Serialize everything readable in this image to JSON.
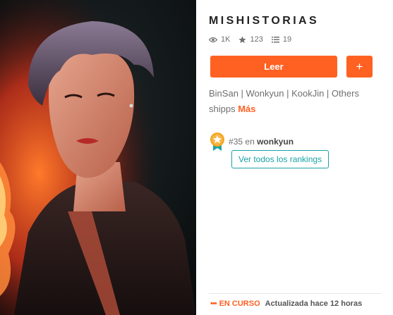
{
  "cover": {
    "image": "cover-photo-portrait"
  },
  "story": {
    "title": "MISHISTORIAS",
    "stats": {
      "reads": "1K",
      "votes": "123",
      "parts": "19"
    },
    "read_label": "Leer",
    "add_label": "+",
    "description": "BinSan | Wonkyun | KookJin | Others shipps",
    "more_label": "Más"
  },
  "ranking": {
    "rank_prefix": "#",
    "rank": "35",
    "in_label": "en",
    "tag": "wonkyun",
    "button_label": "Ver todos los rankings"
  },
  "status": {
    "dots": "•••",
    "label": "EN CURSO",
    "updated": "Actualizada hace 12 horas"
  },
  "colors": {
    "accent": "#ff6122",
    "teal": "#19a2a6",
    "text_muted": "#6f6f6f"
  },
  "icons": [
    "eye-icon",
    "star-icon",
    "list-icon",
    "ranking-badge-icon"
  ]
}
